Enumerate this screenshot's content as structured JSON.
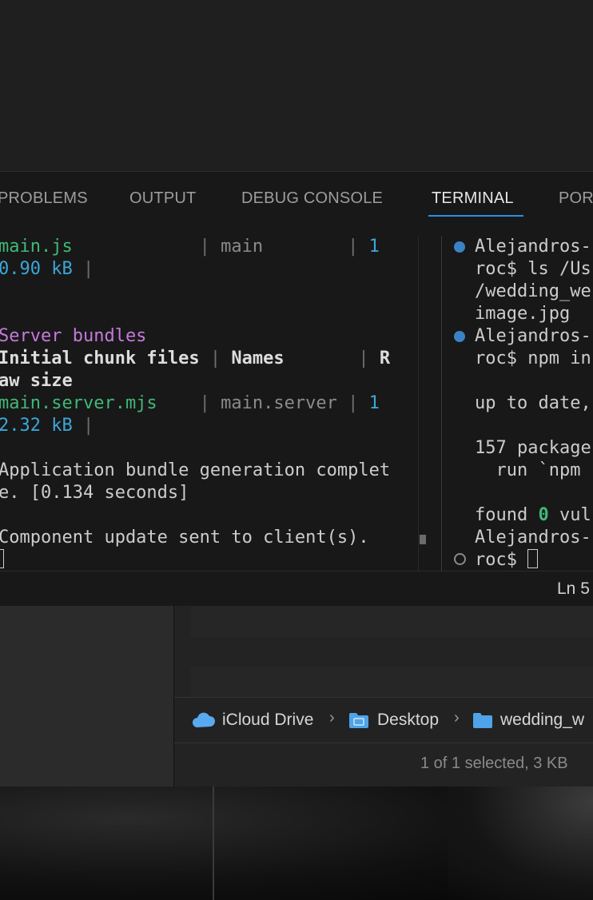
{
  "panel": {
    "tabs": [
      "PROBLEMS",
      "OUTPUT",
      "DEBUG CONSOLE",
      "TERMINAL",
      "POR"
    ],
    "active_tab": "TERMINAL"
  },
  "terminal_left": {
    "line1_file": "main.js",
    "line1_name": "main",
    "line1_num": "1",
    "line2_size": "0.90 kB",
    "server_bundles": "Server bundles",
    "header_files": "Initial chunk files",
    "header_names": "Names",
    "header_raw": "R",
    "header_cont": "aw size",
    "line3_file": "main.server.mjs",
    "line3_name": "main.server",
    "line3_num": "1",
    "line4_size": "2.32 kB",
    "bundle_msg1": "Application bundle generation complet",
    "bundle_msg2": "e. [0.134 seconds]",
    "update_msg": "Component update sent to client(s)."
  },
  "terminal_right": {
    "line1": "Alejandros-",
    "line2": "roc$ ls /Us",
    "line3": "/wedding_we",
    "line4": "image.jpg",
    "line5": "Alejandros-",
    "line6": "roc$ npm in",
    "line7": "up to date,",
    "line8": "157 package",
    "line9": "  run `npm",
    "line10_pre": "found ",
    "line10_num": "0",
    "line10_post": " vul",
    "line11": "Alejandros-",
    "line12": "roc$ "
  },
  "status_bar": {
    "position": "Ln 5"
  },
  "finder": {
    "path": [
      "iCloud Drive",
      "Desktop",
      "wedding_w"
    ],
    "status": "1 of 1 selected, 3 KB"
  },
  "colors": {
    "accent": "#2b8ee6",
    "green": "#3fb977",
    "blue": "#3ba7d9",
    "magenta": "#c678dd"
  }
}
